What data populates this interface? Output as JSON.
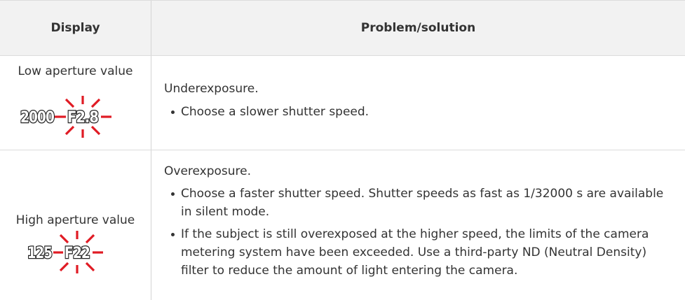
{
  "table": {
    "headers": {
      "display": "Display",
      "problem": "Problem/solution"
    },
    "rows": [
      {
        "display_label": "Low aperture value",
        "lcd": {
          "shutter": "2000",
          "aperture": "F2.8",
          "blink_color": "#e01b24"
        },
        "lead": "Underexposure.",
        "bullets": [
          "Choose a slower shutter speed."
        ]
      },
      {
        "display_label": "High aperture value",
        "lcd": {
          "shutter": "125",
          "aperture": "F22",
          "blink_color": "#e01b24"
        },
        "lead": "Overexposure.",
        "bullets": [
          "Choose a faster shutter speed. Shutter speeds as fast as 1/32000 s are available in silent mode.",
          "If the subject is still overexposed at the higher speed, the limits of the camera metering system have been exceeded. Use a third-party ND (Neutral Density) filter to reduce the amount of light entering the camera."
        ]
      }
    ]
  }
}
